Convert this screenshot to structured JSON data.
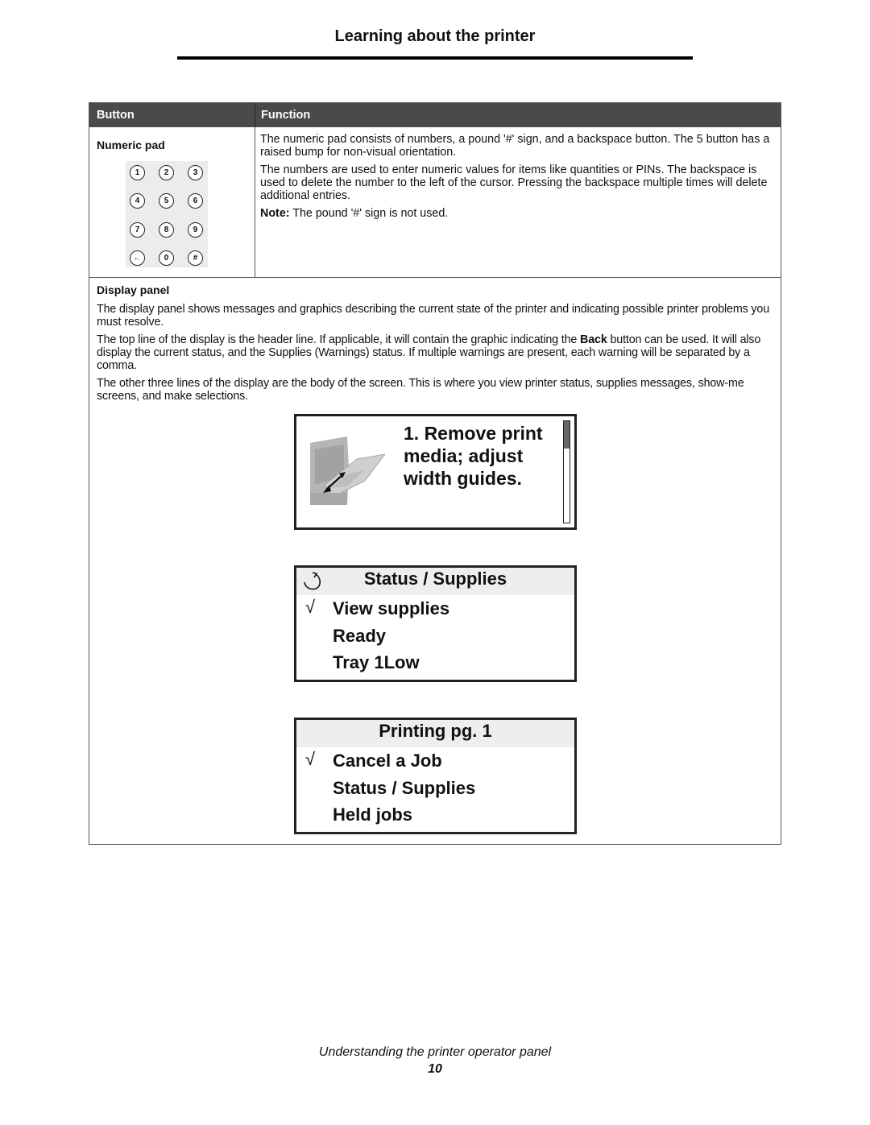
{
  "header": {
    "title": "Learning about the printer"
  },
  "table": {
    "columns": [
      "Button",
      "Function"
    ],
    "numeric_pad": {
      "title": "Numeric pad",
      "keys": [
        "1",
        "2",
        "3",
        "4",
        "5",
        "6",
        "7",
        "8",
        "9",
        "←",
        "0",
        "#"
      ],
      "key_icons": [
        "digit-1",
        "digit-2",
        "digit-3",
        "digit-4",
        "digit-5",
        "digit-6",
        "digit-7",
        "digit-8",
        "digit-9",
        "backspace-icon",
        "digit-0",
        "pound-icon"
      ],
      "paragraphs": [
        "The numeric pad consists of numbers, a pound '#' sign, and a backspace button. The 5 button has a raised bump for non-visual orientation.",
        "The numbers are used to enter numeric values for items like quantities or PINs. The backspace is used to delete the number to the left of the cursor. Pressing the backspace multiple times will delete additional entries."
      ],
      "note_label": "Note:",
      "note_text": " The pound '#' sign is not used."
    },
    "display_panel": {
      "title": "Display panel",
      "para1": "The display panel shows messages and graphics describing the current state of the printer and indicating possible printer problems you must resolve.",
      "para2_before": "The top line of the display is the header line. If applicable, it will contain the graphic indicating the ",
      "para2_bold": "Back",
      "para2_after": " button can be used. It will also display the current status, and the Supplies (Warnings) status. If multiple warnings are present, each warning will be separated by a comma.",
      "para3": "The other three lines of the display are the body of the screen. This is where you view printer status, supplies messages, show-me screens, and make selections."
    }
  },
  "screens": {
    "screen1": {
      "image_icon": "printer-multipurpose-feeder-illustration",
      "lines": [
        "1. Remove print",
        "media; adjust",
        "width guides."
      ],
      "scroll_position": 0.27
    },
    "screen2": {
      "back_icon": "back-arrow-icon",
      "header": "Status / Supplies",
      "items": [
        "View supplies",
        "Ready",
        "Tray 1Low"
      ],
      "selected_index": 0,
      "check_glyph": "√"
    },
    "screen3": {
      "header": "Printing pg. 1",
      "items": [
        "Cancel a Job",
        "Status / Supplies",
        "Held jobs"
      ],
      "selected_index": 0,
      "check_glyph": "√"
    }
  },
  "footer": {
    "section": "Understanding the printer operator panel",
    "page_number": "10"
  }
}
